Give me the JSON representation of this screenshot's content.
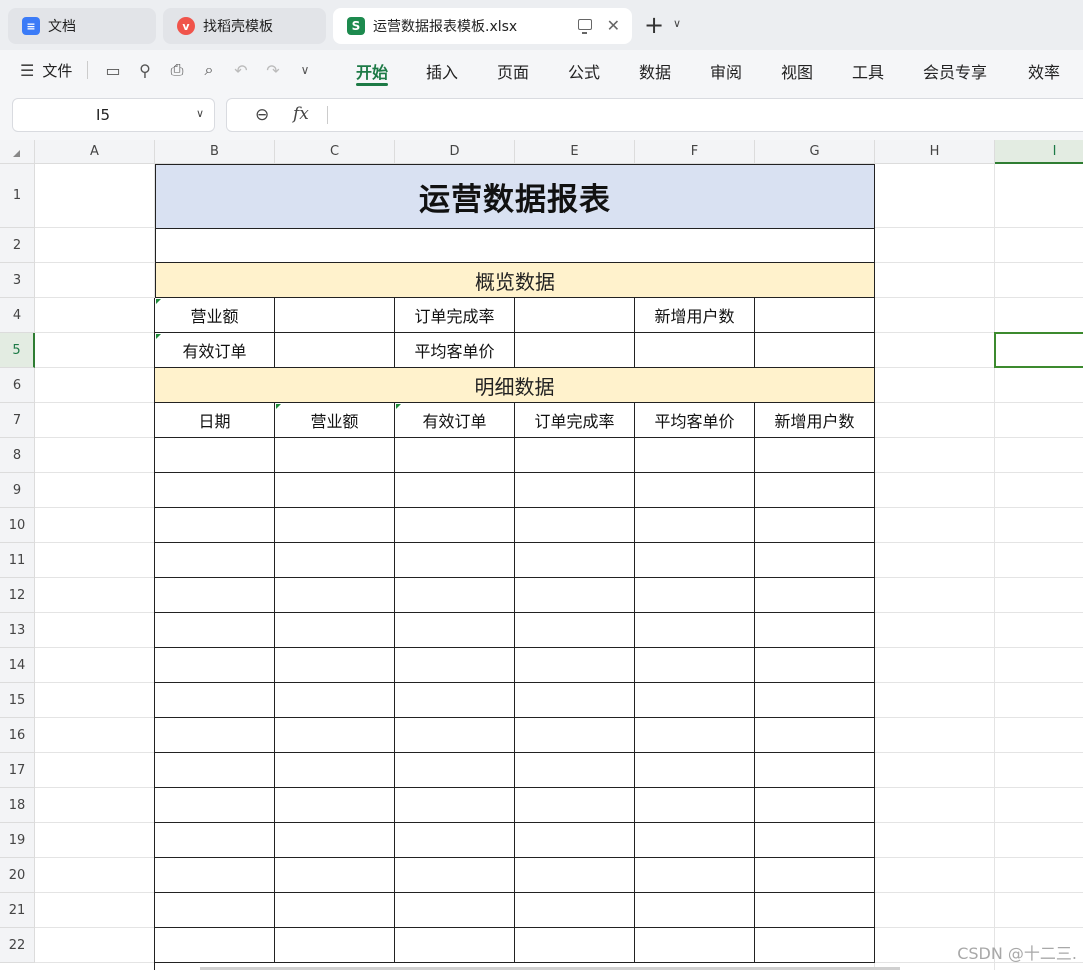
{
  "tabs": [
    {
      "label": "文档",
      "icon": "docs-icon",
      "color": "#3b7bf7"
    },
    {
      "label": "找稻壳模板",
      "icon": "docer-icon",
      "color": "#f0544b"
    },
    {
      "label": "运营数据报表模板.xlsx",
      "icon": "spreadsheet-icon",
      "color": "#1d8a4e",
      "icon_text": "S"
    }
  ],
  "toolbar": {
    "file_label": "文件",
    "menu": [
      "开始",
      "插入",
      "页面",
      "公式",
      "数据",
      "审阅",
      "视图",
      "工具",
      "会员专享",
      "效率"
    ],
    "active_menu": "开始",
    "accent": "#1d7a46"
  },
  "formula_bar": {
    "name_box": "I5",
    "fx": "fx",
    "formula": ""
  },
  "sheet": {
    "columns": [
      "A",
      "B",
      "C",
      "D",
      "E",
      "F",
      "G",
      "H",
      "I"
    ],
    "selected_column": "I",
    "rows": [
      "1",
      "2",
      "3",
      "4",
      "5",
      "6",
      "7",
      "8",
      "9",
      "10",
      "11",
      "12",
      "13",
      "14",
      "15",
      "16",
      "17",
      "18",
      "19",
      "20",
      "21",
      "22"
    ],
    "selected_row": "5",
    "title": "运营数据报表",
    "title_fill": "#d9e1f2",
    "section_fill": "#fff2cc",
    "overview_header": "概览数据",
    "overview_row1": [
      "营业额",
      "",
      "订单完成率",
      "",
      "新增用户数",
      ""
    ],
    "overview_row2": [
      "有效订单",
      "",
      "平均客单价",
      "",
      "",
      ""
    ],
    "detail_header": "明细数据",
    "detail_columns": [
      "日期",
      "营业额",
      "有效订单",
      "订单完成率",
      "平均客单价",
      "新增用户数"
    ]
  },
  "watermark": "CSDN @十二三."
}
